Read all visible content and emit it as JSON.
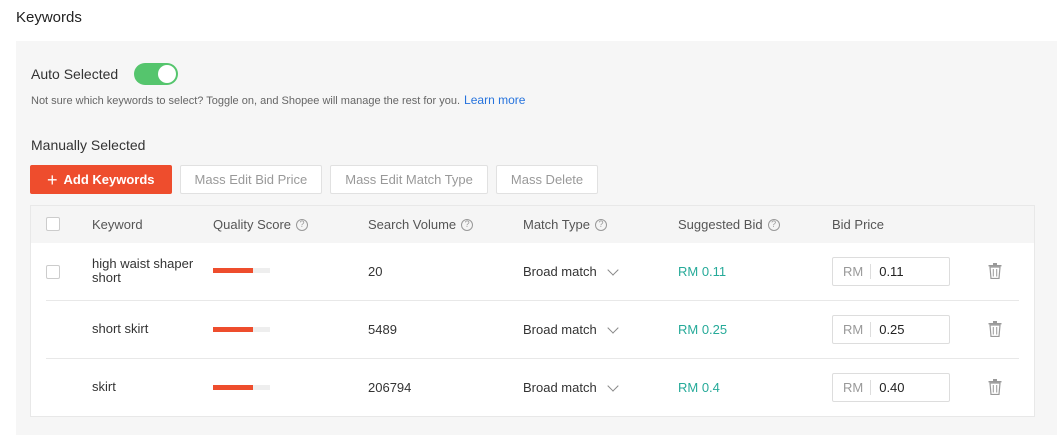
{
  "page": {
    "title": "Keywords"
  },
  "auto": {
    "label": "Auto Selected",
    "enabled": true,
    "hint": "Not sure which keywords to select? Toggle on, and Shopee will manage the rest for you.",
    "learn_more": "Learn more"
  },
  "manual": {
    "title": "Manually Selected",
    "buttons": {
      "add": "Add Keywords",
      "mass_bid": "Mass Edit Bid Price",
      "mass_match": "Mass Edit Match Type",
      "mass_delete": "Mass Delete"
    }
  },
  "table": {
    "headers": {
      "keyword": "Keyword",
      "quality": "Quality Score",
      "volume": "Search Volume",
      "match": "Match Type",
      "suggested": "Suggested Bid",
      "bid": "Bid Price"
    },
    "rows": [
      {
        "keyword": "high waist shaper short",
        "quality": 0.7,
        "volume": "20",
        "match": "Broad match",
        "suggested": "RM 0.11",
        "currency": "RM",
        "bid": "0.11",
        "has_checkbox": true
      },
      {
        "keyword": "short skirt",
        "quality": 0.7,
        "volume": "5489",
        "match": "Broad match",
        "suggested": "RM 0.25",
        "currency": "RM",
        "bid": "0.25",
        "has_checkbox": false
      },
      {
        "keyword": "skirt",
        "quality": 0.7,
        "volume": "206794",
        "match": "Broad match",
        "suggested": "RM 0.4",
        "currency": "RM",
        "bid": "0.40",
        "has_checkbox": false
      }
    ]
  },
  "icons": {
    "help": "question-circle-icon",
    "delete": "trash-icon",
    "add": "plus-icon",
    "dropdown": "chevron-down-icon"
  },
  "colors": {
    "primary": "#ee4d2d",
    "toggle_on": "#55c56d",
    "link": "#2673dd",
    "suggested": "#26aa99"
  }
}
